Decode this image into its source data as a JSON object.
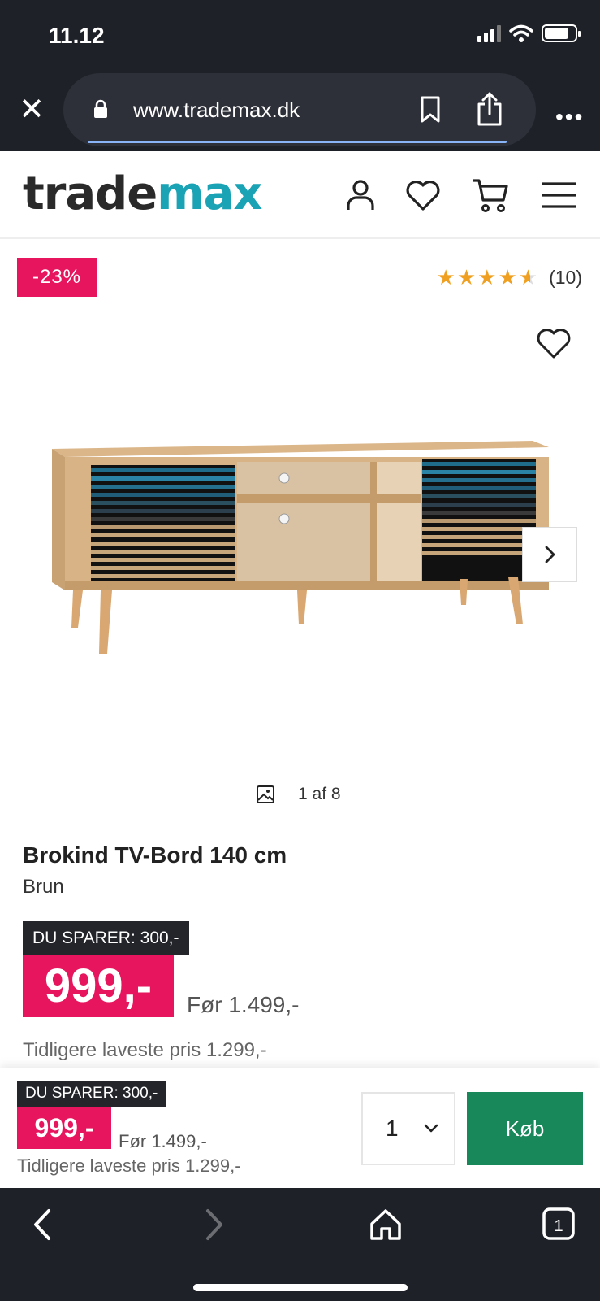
{
  "status_bar": {
    "time": "11.12"
  },
  "browser": {
    "url": "www.trademax.dk"
  },
  "header": {
    "logo_part1": "trade",
    "logo_part2": "max"
  },
  "product": {
    "discount_badge": "-23%",
    "rating_stars": 4.5,
    "rating_count": "(10)",
    "image_counter": "1 af 8",
    "title": "Brokind TV-Bord 140 cm",
    "subtitle": "Brun",
    "save_label": "DU SPARER: 300,-",
    "price": "999,-",
    "before_price": "Før 1.499,-",
    "lowest_price": "Tidligere laveste pris 1.299,-"
  },
  "sticky": {
    "save_label": "DU SPARER: 300,-",
    "price": "999,-",
    "before_price": "Før 1.499,-",
    "lowest_price": "Tidligere laveste pris 1.299,-",
    "quantity": "1",
    "buy_label": "Køb"
  },
  "colors": {
    "accent_pink": "#e6155e",
    "buy_green": "#18875a",
    "logo_teal": "#19a3b5",
    "chrome_dark": "#1f2128"
  }
}
